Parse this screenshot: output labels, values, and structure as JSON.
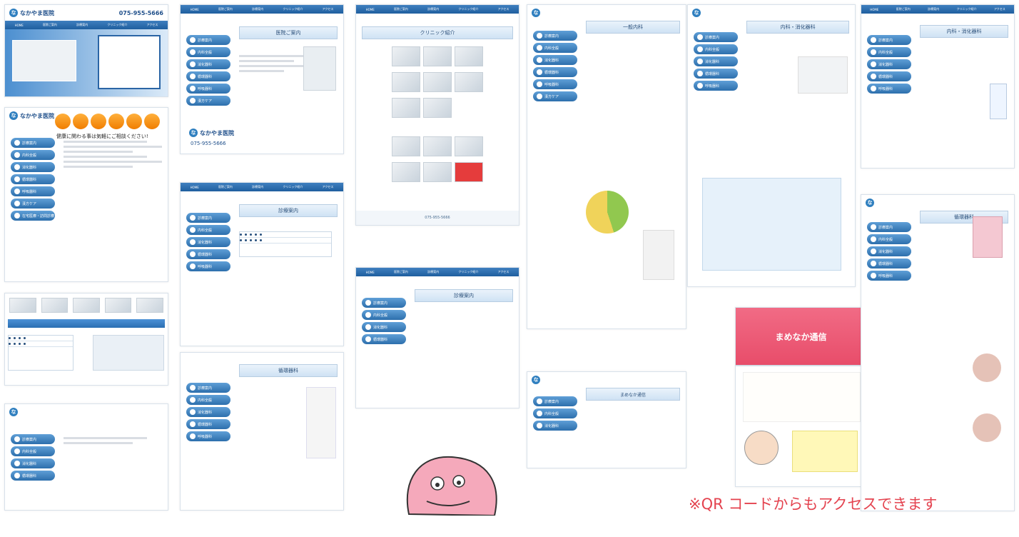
{
  "clinic": {
    "name": "なかやま医院",
    "phone": "075-955-5666",
    "catch_copy": "健康に関わる事は気軽にご相談ください!",
    "news_title": "まめなか通信"
  },
  "nav": [
    "HOME",
    "医院ご案内",
    "診療案内",
    "クリニック紹介",
    "アクセス"
  ],
  "sidebar": [
    "診療案内",
    "内科全般",
    "消化器科",
    "循環器科",
    "呼吸器科",
    "漢方ケア",
    "在宅医療・訪問診療"
  ],
  "sections": [
    "医院ご案内",
    "診療案内",
    "クリニック紹介",
    "一般内科",
    "内科・消化器科",
    "循環器科",
    "まめなか通信"
  ],
  "qr_note": "※QR コードからもアクセスできます"
}
